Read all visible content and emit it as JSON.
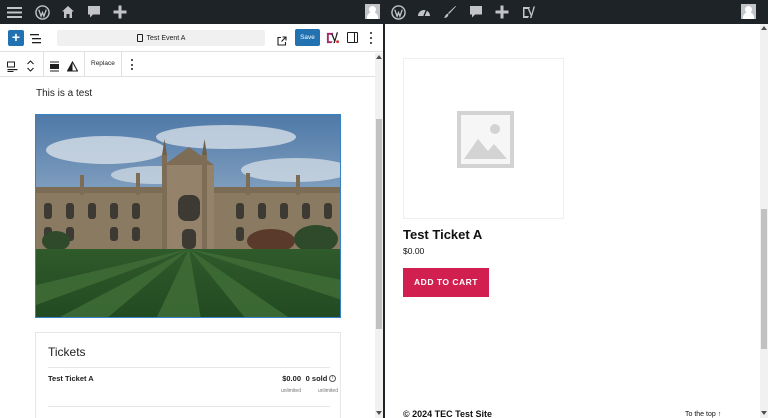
{
  "left_adminbar": {
    "icons": [
      "menu-icon",
      "wordpress-icon",
      "home-icon",
      "comment-icon",
      "plus-icon"
    ]
  },
  "right_adminbar": {
    "icons": [
      "wordpress-icon",
      "dashboard-icon",
      "brush-icon",
      "comment-icon",
      "plus-icon",
      "yoast-icon"
    ]
  },
  "editor_toolbar": {
    "document_title": "Test Event A",
    "save_label": "Save"
  },
  "block_toolbar": {
    "replace_label": "Replace"
  },
  "editor": {
    "paragraph": "This is a test",
    "tickets": {
      "title": "Tickets",
      "rows": [
        {
          "name": "Test Ticket A",
          "price": "$0.00",
          "price_sub": "unlimited",
          "sold": "0 sold",
          "sold_sub": "unlimited"
        }
      ]
    }
  },
  "product": {
    "title": "Test Ticket A",
    "price": "$0.00",
    "cta_label": "ADD TO CART"
  },
  "footer": {
    "left": "© 2024 TEC Test Site",
    "right": "To the top ↑"
  },
  "colors": {
    "adminbar": "#1d2327",
    "primary": "#2271b1",
    "cart_button": "#d1204f"
  }
}
